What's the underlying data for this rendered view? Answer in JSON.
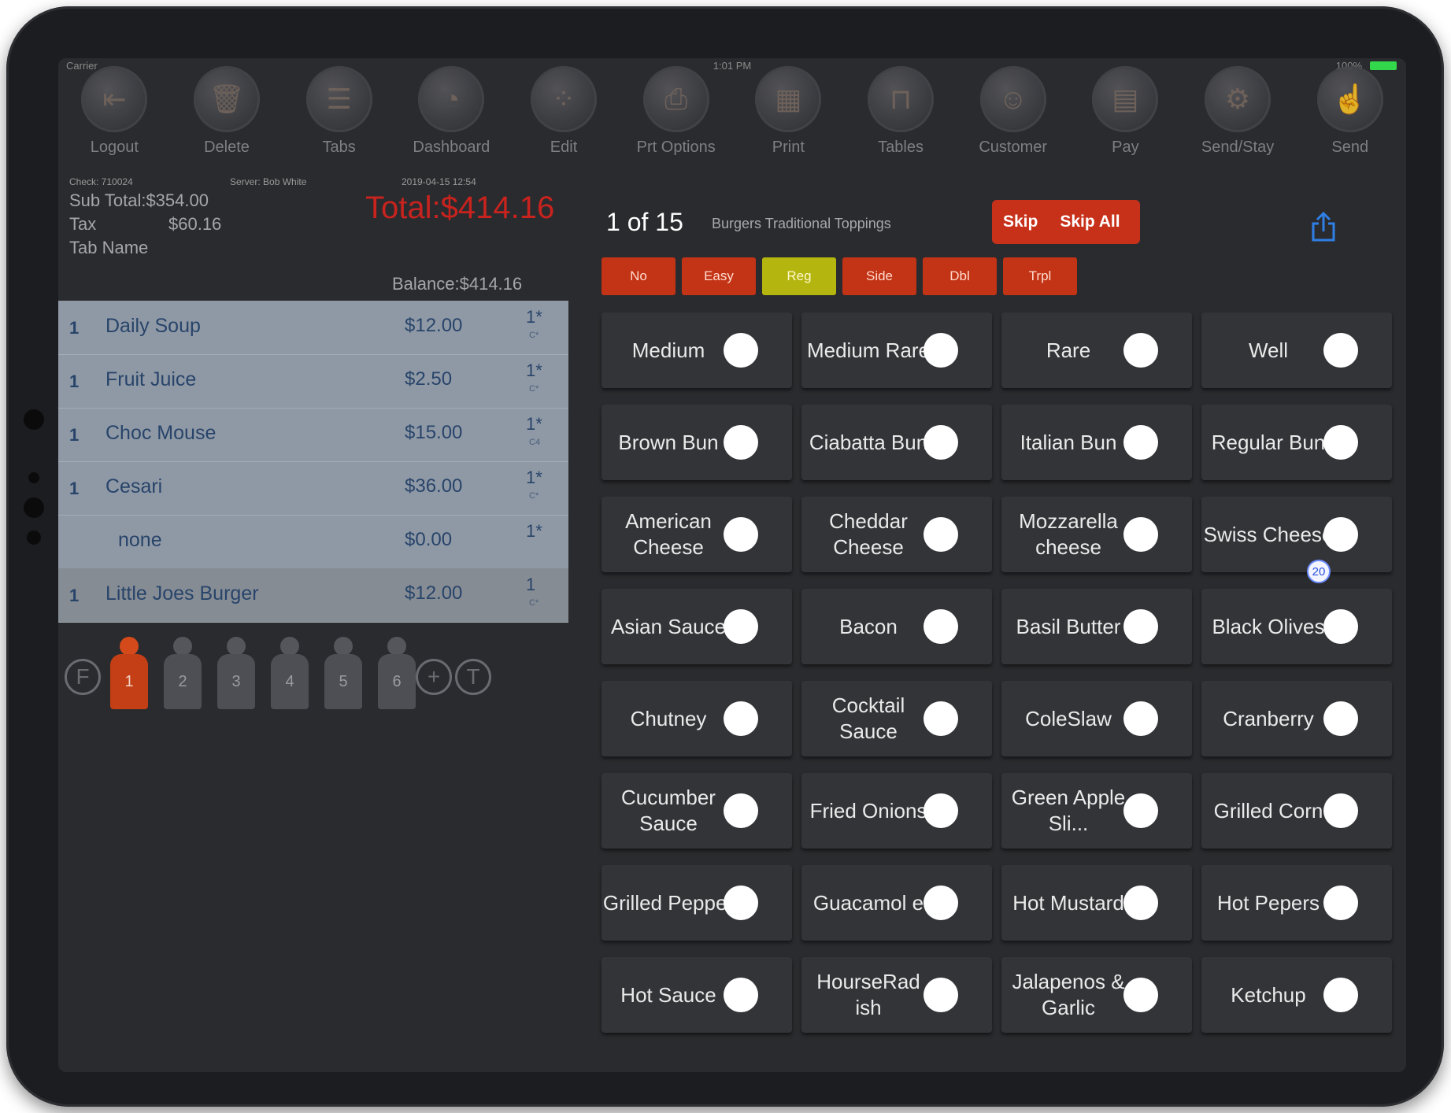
{
  "status": {
    "carrier": "Carrier",
    "time": "1:01 PM",
    "battery": "100%"
  },
  "toolbar": [
    {
      "label": "Logout",
      "icon": "logout-icon",
      "glyph": "⇤"
    },
    {
      "label": "Delete",
      "icon": "trash-icon",
      "glyph": "🗑"
    },
    {
      "label": "Tabs",
      "icon": "list-icon",
      "glyph": "☰"
    },
    {
      "label": "Dashboard",
      "icon": "gauge-icon",
      "glyph": "◔"
    },
    {
      "label": "Edit",
      "icon": "grid-dots-icon",
      "glyph": "⁘"
    },
    {
      "label": "Prt Options",
      "icon": "printer-options-icon",
      "glyph": "⎙"
    },
    {
      "label": "Print",
      "icon": "printer-icon",
      "glyph": "▦"
    },
    {
      "label": "Tables",
      "icon": "table-icon",
      "glyph": "⊓"
    },
    {
      "label": "Customer",
      "icon": "person-icon",
      "glyph": "☺"
    },
    {
      "label": "Pay",
      "icon": "calculator-icon",
      "glyph": "▤"
    },
    {
      "label": "Send/Stay",
      "icon": "gear-icon",
      "glyph": "⚙"
    },
    {
      "label": "Send",
      "icon": "hand-icon",
      "glyph": "☝"
    }
  ],
  "check": {
    "check_no": "Check: 710024",
    "server": "Server: Bob White",
    "datetime": "2019-04-15 12:54",
    "subtotal": "Sub Total:$354.00",
    "tax_label": "Tax",
    "tax_value": "$60.16",
    "tab_name": "Tab Name",
    "total": "Total:$414.16",
    "balance": "Balance:$414.16"
  },
  "orders": [
    {
      "qty": "1",
      "name": "Daily Soup",
      "price": "$12.00",
      "seat": "1*",
      "course": "C*"
    },
    {
      "qty": "1",
      "name": "Fruit Juice",
      "price": "$2.50",
      "seat": "1*",
      "course": "C*"
    },
    {
      "qty": "1",
      "name": "Choc Mouse",
      "price": "$15.00",
      "seat": "1*",
      "course": "C4"
    },
    {
      "qty": "1",
      "name": "Cesari",
      "price": "$36.00",
      "seat": "1*",
      "course": "C*"
    },
    {
      "qty": "",
      "name": "none",
      "price": "$0.00",
      "seat": "1*",
      "course": ""
    },
    {
      "qty": "1",
      "name": "Little Joes Burger",
      "price": "$12.00",
      "seat": "1",
      "course": "C*"
    }
  ],
  "seats": {
    "f_label": "F",
    "t_label": "T",
    "plus_label": "+",
    "items": [
      "1",
      "2",
      "3",
      "4",
      "5",
      "6"
    ],
    "active": "1"
  },
  "modifier_panel": {
    "counter": "1 of 15",
    "breadcrumb": "Burgers Traditional Toppings",
    "skip": "Skip",
    "skip_all": "Skip All",
    "modifiers": [
      "No",
      "Easy",
      "Reg",
      "Side",
      "Dbl",
      "Trpl"
    ],
    "selected_modifier": "Reg",
    "badge": "20",
    "options": [
      "Medium",
      "Medium Rare",
      "Rare",
      "Well",
      "Brown Bun",
      "Ciabatta Bun",
      "Italian Bun",
      "Regular Bun",
      "American Cheese",
      "Cheddar Cheese",
      "Mozzarella cheese",
      "Swiss Cheese",
      "Asian Sauce",
      "Bacon",
      "Basil Butter",
      "Black Olives",
      "Chutney",
      "Cocktail Sauce",
      "ColeSlaw",
      "Cranberry",
      "Cucumber Sauce",
      "Fried Onions",
      "Green Apple Sli...",
      "Grilled Corn",
      "Grilled Pepper",
      "Guacamol e",
      "Hot Mustard",
      "Hot Pepers",
      "Hot Sauce",
      "HourseRad ish",
      "Jalapenos & Garlic",
      "Ketchup"
    ]
  },
  "colors": {
    "accent": "#c7311a",
    "selected": "#b5b50f",
    "total": "#c8231e",
    "battery": "#32d74b"
  }
}
